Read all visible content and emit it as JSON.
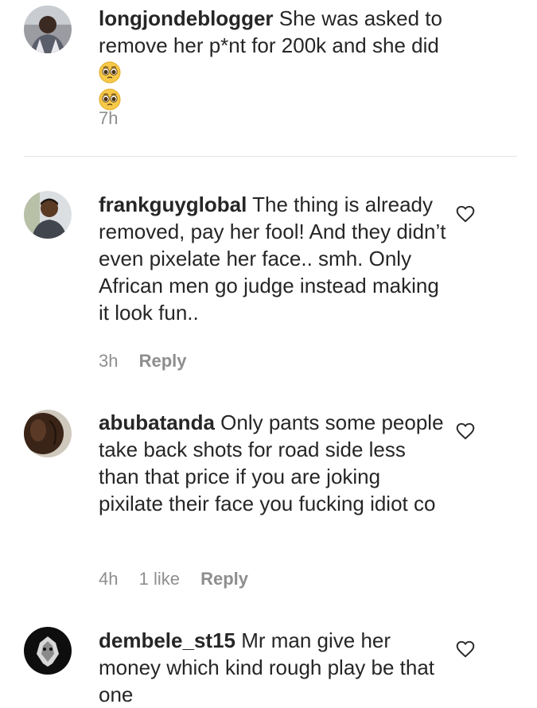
{
  "comments": [
    {
      "username": "longjondeblogger",
      "text_a": " She was asked to remove her p*nt for 200k and she did ",
      "emoji_name": "pleading-face-icon",
      "time": "7h"
    },
    {
      "username": "frankguyglobal",
      "text": " The thing is already removed, pay her fool! And they didn’t even pixelate her face.. smh. Only African men go judge instead making it look fun..",
      "time": "3h",
      "reply": "Reply"
    },
    {
      "username": "abubatanda",
      "text": " Only pants some people take back shots for road side less than that price if you are joking pixilate their face you fucking idiot co",
      "time": "4h",
      "likes": "1 like",
      "reply": "Reply"
    },
    {
      "username": "dembele_st15",
      "text": " Mr man give her money which kind rough play be that one"
    }
  ],
  "colors": {
    "text": "#262626",
    "meta": "#8e8e8e",
    "divider": "#e4e4e4"
  }
}
